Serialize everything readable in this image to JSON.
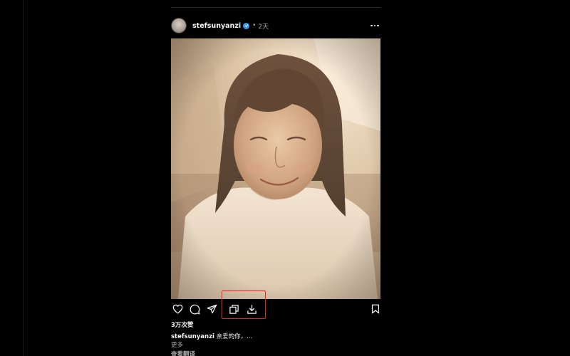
{
  "post": {
    "username": "stefsunyanzi",
    "verified": true,
    "separator": "•",
    "time": "2天",
    "likes": "3万次赞",
    "caption_user": "stefsunyanzi",
    "caption_text": "亲爱的你，...",
    "more_label": "更多",
    "translate_label": "查看翻译"
  },
  "icons": {
    "like": "heart-icon",
    "comment": "comment-icon",
    "share": "send-icon",
    "copy": "copy-icon",
    "download": "download-icon",
    "save": "bookmark-icon",
    "menu": "more-horizontal-icon"
  },
  "colors": {
    "background": "#000000",
    "text": "#f5f5f5",
    "muted": "#a8a8a8",
    "verified": "#3897f0",
    "highlight": "#e0251c"
  }
}
